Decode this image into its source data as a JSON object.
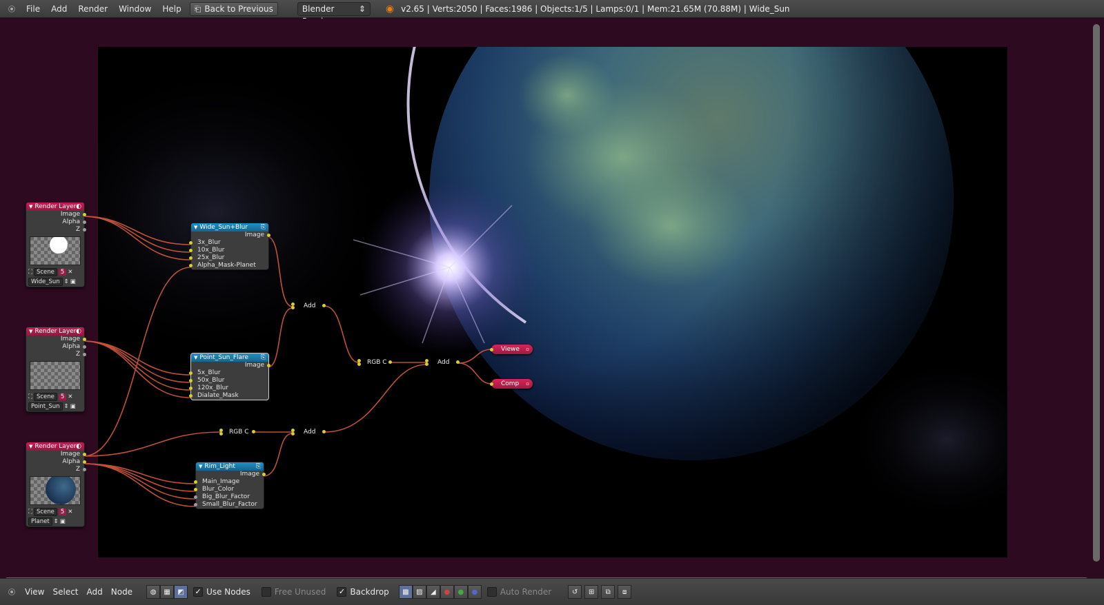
{
  "topbar": {
    "menus": [
      "File",
      "Add",
      "Render",
      "Window",
      "Help"
    ],
    "back_button": "Back to Previous",
    "engine": "Blender Render",
    "stats": "v2.65 | Verts:2050 | Faces:1986 | Objects:1/5 | Lamps:0/1 | Mem:21.65M (70.88M) | Wide_Sun"
  },
  "nodes": {
    "render_layer_1": {
      "title": "Render Layer",
      "outputs": [
        "Image",
        "Alpha",
        "Z"
      ],
      "scene": "Scene",
      "scene_num": "5",
      "layer": "Wide_Sun"
    },
    "render_layer_2": {
      "title": "Render Layer",
      "outputs": [
        "Image",
        "Alpha",
        "Z"
      ],
      "scene": "Scene",
      "scene_num": "5",
      "layer": "Point_Sun"
    },
    "render_layer_3": {
      "title": "Render Layer",
      "outputs": [
        "Image",
        "Alpha",
        "Z"
      ],
      "scene": "Scene",
      "scene_num": "5",
      "layer": "Planet"
    },
    "wide_sun_blur": {
      "title": "Wide_Sun+Blur",
      "output": "Image",
      "inputs": [
        "3x_Blur",
        "10x_Blur",
        "25x_Blur",
        "Alpha_Mask-Planet"
      ]
    },
    "point_sun_flare": {
      "title": "Point_Sun_Flare",
      "output": "Image",
      "inputs": [
        "5x_Blur",
        "50x_Blur",
        "120x_Blur",
        "Dialate_Mask"
      ]
    },
    "rim_light": {
      "title": "Rim_Light",
      "output": "Image",
      "inputs": [
        "Main_Image",
        "Blur_Color",
        "Big_Blur_Factor",
        "Small_Blur_Factor"
      ]
    },
    "add_1": "Add",
    "add_2": "Add",
    "add_3": "Add",
    "rgb_1": "RGB C",
    "rgb_2": "RGB C",
    "viewer": "Viewe",
    "composite": "Comp"
  },
  "bottombar": {
    "menus": [
      "View",
      "Select",
      "Add",
      "Node"
    ],
    "use_nodes": "Use Nodes",
    "free_unused": "Free Unused",
    "backdrop": "Backdrop",
    "auto_render": "Auto Render"
  },
  "colors": {
    "render_layer_header": "#c21f55",
    "group_header": "#1f8fc6",
    "editor_bg": "#2e0a20",
    "socket": "#d6cf30"
  },
  "icons": [
    "blender-logo-icon",
    "back-icon",
    "node-tree-icons",
    "snap-icons"
  ]
}
